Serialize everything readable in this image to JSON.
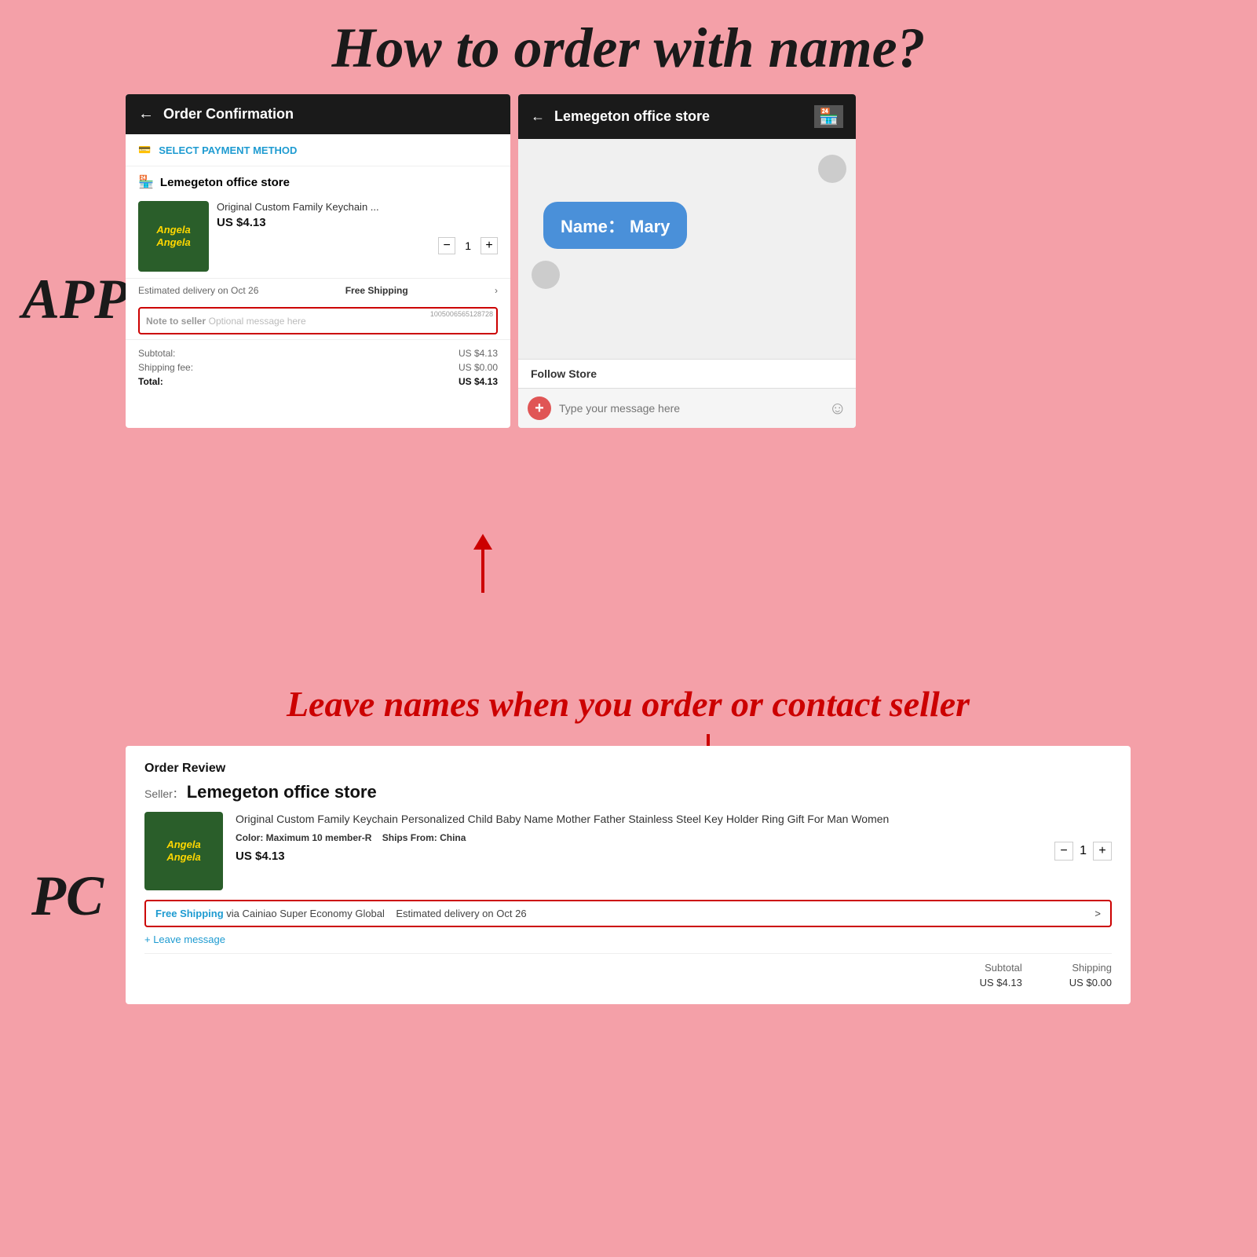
{
  "page": {
    "background": "#f4a0a8",
    "main_title": "How to order with name?",
    "app_label": "APP",
    "pc_label": "PC",
    "instruction_text": "Leave names when you order or contact seller"
  },
  "app_left": {
    "header": {
      "back": "←",
      "title": "Order Confirmation"
    },
    "payment": {
      "label": "SELECT PAYMENT METHOD"
    },
    "store": {
      "name": "Lemegeton office store"
    },
    "product": {
      "name": "Original Custom Family Keychain ...",
      "price": "US $4.13",
      "image_text": "Angela\nAngela",
      "qty": "1"
    },
    "delivery": {
      "text": "Estimated delivery on Oct 26",
      "shipping": "Free Shipping"
    },
    "note": {
      "label": "Note to seller",
      "placeholder": "Optional message here",
      "id": "1005006565128728"
    },
    "totals": {
      "subtotal_label": "Subtotal:",
      "subtotal_value": "US $4.13",
      "shipping_label": "Shipping fee:",
      "shipping_value": "US $0.00",
      "total_label": "Total:",
      "total_value": "US $4.13"
    }
  },
  "app_right": {
    "header": {
      "back": "←",
      "store_name": "Lemegeton office store"
    },
    "message_bubble": {
      "text": "Name：  Mary"
    },
    "follow_store": {
      "label": "Follow Store"
    },
    "input": {
      "add_btn": "+",
      "placeholder": "Type your message here",
      "emoji": "☺"
    }
  },
  "pc": {
    "order_review_label": "Order Review",
    "seller_prefix": "Seller：",
    "seller_name": "Lemegeton office store",
    "product": {
      "name": "Original Custom Family Keychain Personalized Child Baby Name Mother Father Stainless Steel Key Holder Ring Gift For Man Women",
      "image_text": "Angela\nAngela",
      "color_label": "Color:",
      "color_value": "Maximum 10 member-R",
      "ships_label": "Ships From:",
      "ships_value": "China",
      "price": "US $4.13",
      "qty": "1"
    },
    "shipping_row": {
      "free_text": "Free Shipping",
      "via_text": "via Cainiao Super Economy Global",
      "estimated": "Estimated delivery on Oct 26",
      "chevron": ">"
    },
    "leave_message": "+ Leave message",
    "totals": {
      "subtotal_label": "Subtotal",
      "subtotal_value": "US $4.13",
      "shipping_label": "Shipping",
      "shipping_value": "US $0.00"
    }
  }
}
